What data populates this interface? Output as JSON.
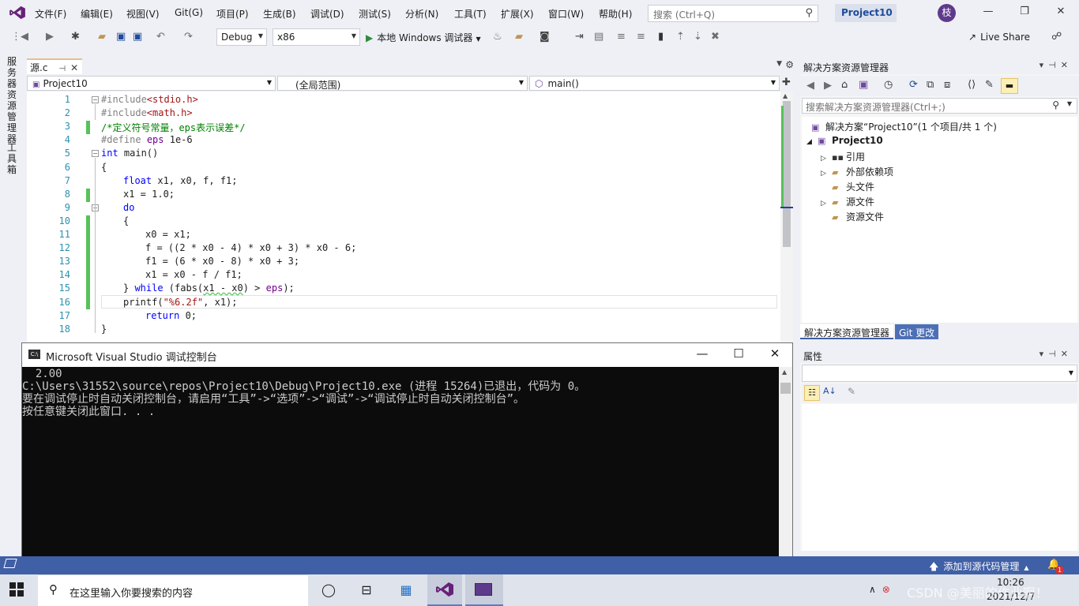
{
  "menubar": {
    "items": [
      "文件(F)",
      "编辑(E)",
      "视图(V)",
      "Git(G)",
      "项目(P)",
      "生成(B)",
      "调试(D)",
      "测试(S)",
      "分析(N)",
      "工具(T)",
      "扩展(X)",
      "窗口(W)",
      "帮助(H)"
    ],
    "search_placeholder": "搜索 (Ctrl+Q)",
    "project_badge": "Project10",
    "avatar_initial": "枝"
  },
  "toolbar": {
    "config": "Debug",
    "platform": "x86",
    "run_label": "本地 Windows 调试器",
    "live_share": "Live Share"
  },
  "left_strip": {
    "server_explorer": "服务器资源管理器",
    "toolbox": "工具箱"
  },
  "editor": {
    "tab_label": "源.c",
    "nav_project": "Project10",
    "nav_scope": "(全局范围)",
    "nav_member": "main()",
    "lines": [
      "1",
      "2",
      "3",
      "4",
      "5",
      "6",
      "7",
      "8",
      "9",
      "10",
      "11",
      "12",
      "13",
      "14",
      "15",
      "16",
      "17",
      "18"
    ],
    "code": {
      "l1a": "#include",
      "l1b": "<stdio.h>",
      "l2a": "#include",
      "l2b": "<math.h>",
      "l3": "/*定义符号常量，eps表示误差*/",
      "l4a": "#define",
      "l4b": "eps",
      "l4c": "1e-6",
      "l5a": "int",
      "l5b": " main()",
      "l6": "{",
      "l7a": "float",
      "l7b": " x1, x0, f, f1;",
      "l8": "x1 = 1.0;",
      "l9": "do",
      "l10": "{",
      "l11": "x0 = x1;",
      "l12": "f = ((2 * x0 - 4) * x0 + 3) * x0 - 6;",
      "l13": "f1 = (6 * x0 - 8) * x0 + 3;",
      "l14": "x1 = x0 - f / f1;",
      "l15a": "} ",
      "l15b": "while",
      "l15c": " (fabs(",
      "l15d": "x1 - x0",
      "l15e": ") > ",
      "l15f": "eps",
      "l15g": ");",
      "l16a": "printf(",
      "l16b": "\"%6.2f\"",
      "l16c": ", x1);",
      "l17a": "return",
      "l17b": " 0;",
      "l18": "}"
    }
  },
  "console": {
    "title": "Microsoft Visual Studio 调试控制台",
    "icon_text": "C:\\",
    "output": [
      "  2.00",
      "C:\\Users\\31552\\source\\repos\\Project10\\Debug\\Project10.exe (进程 15264)已退出，代码为 0。",
      "要在调试停止时自动关闭控制台，请启用“工具”->“选项”->“调试”->“调试停止时自动关闭控制台”。",
      "按任意键关闭此窗口. . ."
    ]
  },
  "solution_explorer": {
    "title": "解决方案资源管理器",
    "search_placeholder": "搜索解决方案资源管理器(Ctrl+;)",
    "solution_label": "解决方案“Project10”(1 个项目/共 1 个)",
    "project": "Project10",
    "nodes": [
      "引用",
      "外部依赖项",
      "头文件",
      "源文件",
      "资源文件"
    ],
    "tab_active": "解决方案资源管理器",
    "tab_git": "Git 更改"
  },
  "properties": {
    "title": "属性"
  },
  "statusbar": {
    "source_control": "添加到源代码管理",
    "notification_count": "1"
  },
  "taskbar": {
    "search_placeholder": "在这里输入你要搜索的内容",
    "time": "10:26",
    "date": "2021/12/7",
    "watermark": "CSDN @美丽的作业啊！"
  },
  "colors": {
    "accent": "#3f5fa6",
    "change_bar": "#57c25a",
    "console_bg": "#0c0c0c",
    "keyword": "#0000ff",
    "comment": "#008000",
    "string": "#a31515"
  }
}
